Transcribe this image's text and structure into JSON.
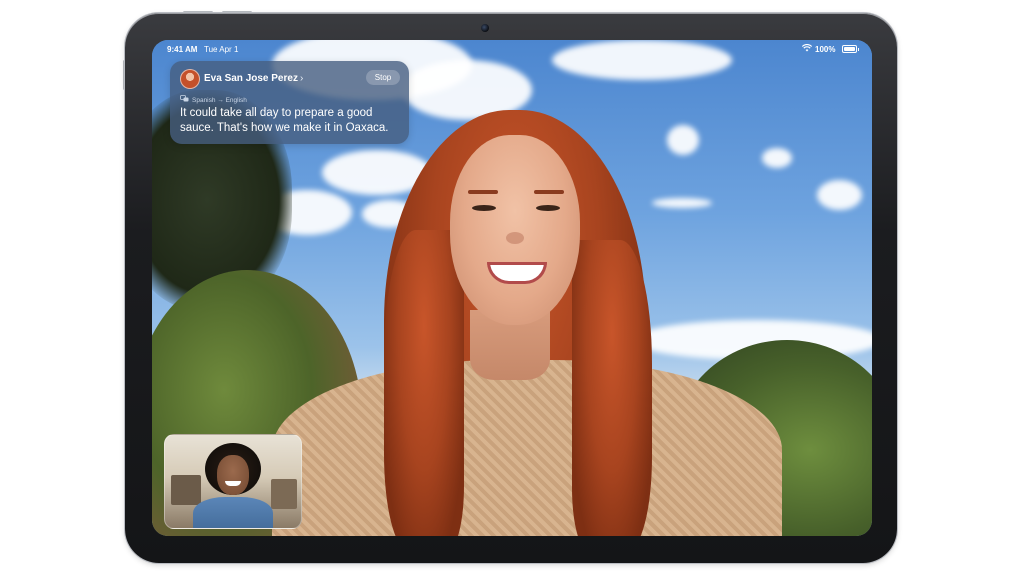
{
  "status_bar": {
    "time": "9:41 AM",
    "date": "Tue Apr 1",
    "battery": "100%"
  },
  "translation_banner": {
    "caller_name": "Eva San Jose Perez",
    "chevron": "›",
    "stop_label": "Stop",
    "languages": "Spanish → English",
    "translated_text": "It could take all day to prepare a good sauce. That's how we make it in Oaxaca."
  },
  "icons": {
    "wifi": "wifi-icon",
    "battery": "battery-icon",
    "translate": "translate-icon",
    "camera": "front-camera-icon"
  },
  "colors": {
    "banner_bg": "#465e80",
    "device_frame": "#1b1c1f",
    "sky": "#5f95d6"
  }
}
